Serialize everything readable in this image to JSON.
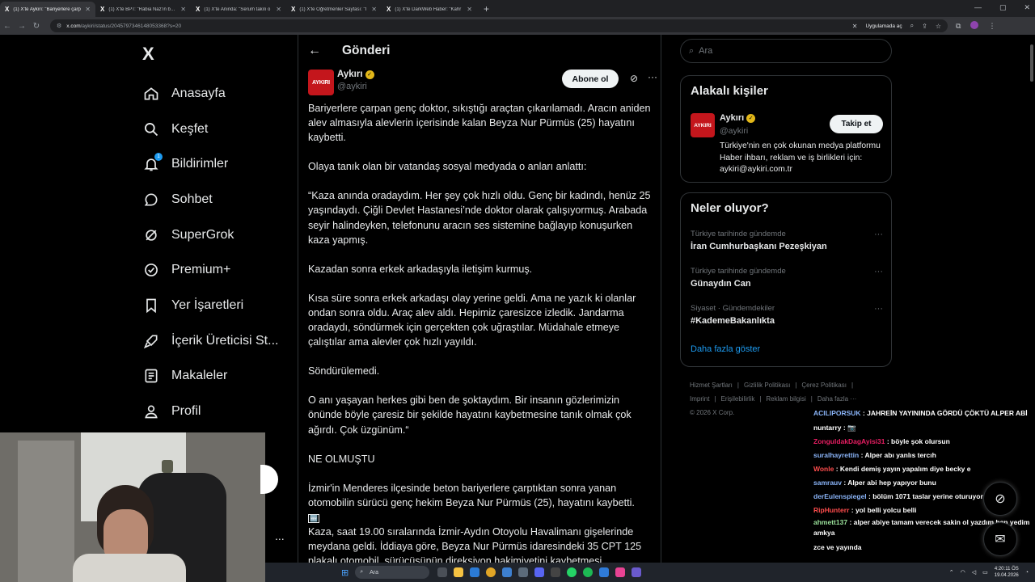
{
  "browser": {
    "tabs": [
      {
        "title": "(1) X'te Aykırı: \"Bariyerlere çarp",
        "active": true
      },
      {
        "title": "(1) X'te BPT: \"Rabia Naz'ın babı",
        "active": false
      },
      {
        "title": "(1) X'te Anında: \"Serum takılı o",
        "active": false
      },
      {
        "title": "(1) X'te Öğretmenler Sayfası: \"I",
        "active": false
      },
      {
        "title": "(1) X'te DarkWeb Haber: \"Kahr",
        "active": false
      }
    ],
    "url_domain": "x.com",
    "url_path": "/aykiri/status/2045797346148053368?s=20",
    "apps_label": "Uygulamada aç"
  },
  "nav": {
    "logo": "X",
    "items": [
      {
        "label": "Anasayfa",
        "icon": "home-icon"
      },
      {
        "label": "Keşfet",
        "icon": "search-icon"
      },
      {
        "label": "Bildirimler",
        "icon": "bell-icon",
        "badge": "1"
      },
      {
        "label": "Sohbet",
        "icon": "chat-icon"
      },
      {
        "label": "SuperGrok",
        "icon": "grok-icon"
      },
      {
        "label": "Premium+",
        "icon": "premium-icon"
      },
      {
        "label": "Yer İşaretleri",
        "icon": "bookmark-icon"
      },
      {
        "label": "İçerik Üreticisi St...",
        "icon": "rocket-icon"
      },
      {
        "label": "Makaleler",
        "icon": "article-icon"
      },
      {
        "label": "Profil",
        "icon": "profile-icon"
      }
    ],
    "more": "..."
  },
  "post_page": {
    "title": "Gönderi",
    "author": {
      "name": "Aykırı",
      "handle": "@aykiri",
      "avatar_text": "AYKIRI"
    },
    "subscribe_label": "Abone ol",
    "paragraphs": [
      "Bariyerlere çarpan genç doktor, sıkıştığı araçtan çıkarılamadı. Aracın aniden alev almasıyla alevlerin içerisinde kalan Beyza Nur Pürmüs (25) hayatını kaybetti.",
      "Olaya tanık olan bir vatandaş sosyal medyada o anları anlattı:",
      "“Kaza anında oradaydım. Her şey çok hızlı oldu. Genç bir kadındı, henüz 25 yaşındaydı. Çiğli Devlet Hastanesi’nde doktor olarak çalışıyormuş. Arabada seyir halindeyken, telefonunu aracın ses sistemine bağlayıp konuşurken kaza yapmış.",
      "Kazadan sonra erkek arkadaşıyla iletişim kurmuş.",
      "Kısa süre sonra erkek arkadaşı olay yerine geldi. Ama ne yazık ki olanlar ondan sonra oldu. Araç alev aldı. Hepimiz çaresizce izledik. Jandarma oradaydı, söndürmek için gerçekten çok uğraştılar. Müdahale etmeye çalıştılar ama alevler çok hızlı yayıldı.",
      "Söndürülemedi.",
      "O anı yaşayan herkes gibi ben de şoktaydım. Bir insanın gözlerimizin önünde böyle çaresiz bir şekilde hayatını kaybetmesine tanık olmak çok ağırdı. Çok üzgünüm.“",
      "NE OLMUŞTU"
    ],
    "para_izmir": "İzmir'in Menderes ilçesinde beton bariyerlere çarptıktan sonra yanan otomobilin sürücü genç hekim Beyza Nur Pürmüs (25), hayatını kaybetti.",
    "box_emoji": "🆕",
    "para_last": "Kaza, saat 19.00 sıralarında İzmir-Aydın Otoyolu Havalimanı gişelerinde meydana geldi. İddiaya göre, Beyza Nur Pürmüs idaresindeki 35 CPT 125 plakalı otomobil, sürücüsünün direksiyon hakimiyetini kaybetmesi"
  },
  "right": {
    "search_placeholder": "Ara",
    "related": {
      "title": "Alakalı kişiler",
      "name": "Aykırı",
      "handle": "@aykiri",
      "avatar_text": "AYKIRI",
      "follow_label": "Takip et",
      "bio": "Türkiye'nin en çok okunan medya platformu Haber ihbarı, reklam ve iş birlikleri için: aykiri@aykiri.com.tr"
    },
    "trends": {
      "title": "Neler oluyor?",
      "items": [
        {
          "context": "Türkiye tarihinde gündemde",
          "topic": "İran Cumhurbaşkanı Pezeşkiyan"
        },
        {
          "context": "Türkiye tarihinde gündemde",
          "topic": "Günaydın Can"
        },
        {
          "context": "Siyaset · Gündemdekiler",
          "topic": "#KademeBakanlıkta"
        }
      ],
      "show_more": "Daha fazla göster"
    },
    "footer": {
      "links": [
        "Hizmet Şartları",
        "|",
        "Gizlilik Politikası",
        "|",
        "Çerez Politikası",
        "|",
        "Imprint",
        "|",
        "Erişilebilirlik",
        "|",
        "Reklam bilgisi",
        "|",
        "Daha fazla ···"
      ],
      "copyright": "© 2026 X Corp."
    }
  },
  "chat": [
    {
      "user": "ACILIPORSUK",
      "text": ": JAHREİN YAYININDA GÖRDÜ ÇÖKTÜ ALPER ABİ",
      "color": "#8ab4f8",
      "wrap": true
    },
    {
      "user": "nuntarry",
      "text": ": 📷",
      "color": "#ffffff"
    },
    {
      "user": "ZonguldakDagAyisi31",
      "text": ": böyle şok olursun",
      "color": "#e91e63"
    },
    {
      "user": "suralhayrettin",
      "text": ": Alper abı yanlıs tercıh",
      "color": "#8ab4f8"
    },
    {
      "user": "Wonle",
      "text": ": Kendi demiş yayın yapalım diye becky e",
      "color": "#ff4d4d"
    },
    {
      "user": "samrauv",
      "text": ": Alper abi hep yapıyor bunu",
      "color": "#8ab4f8"
    },
    {
      "user": "derEulenspiegel",
      "text": ": bölüm 1071 taslar yerine oturuyor",
      "color": "#8ab4f8"
    },
    {
      "user": "RipHunterr",
      "text": ": yol belli yolcu belli",
      "color": "#ff4d4d"
    },
    {
      "user": "ahmett137",
      "text": ": alper abiye tamam verecek sakin ol yazdım ban yedim amkya",
      "color": "#9be29b",
      "wrap": true
    },
    {
      "user": "",
      "text": "zce ve yayında",
      "color": "#ffffff"
    }
  ],
  "taskbar": {
    "search_label": "Ara",
    "time": "4:20:11 ÖS",
    "date": "19.04.2026"
  },
  "colors": {
    "accent": "#1d9bf0",
    "brand_red": "#c4161c",
    "verified": "#e2b719"
  }
}
